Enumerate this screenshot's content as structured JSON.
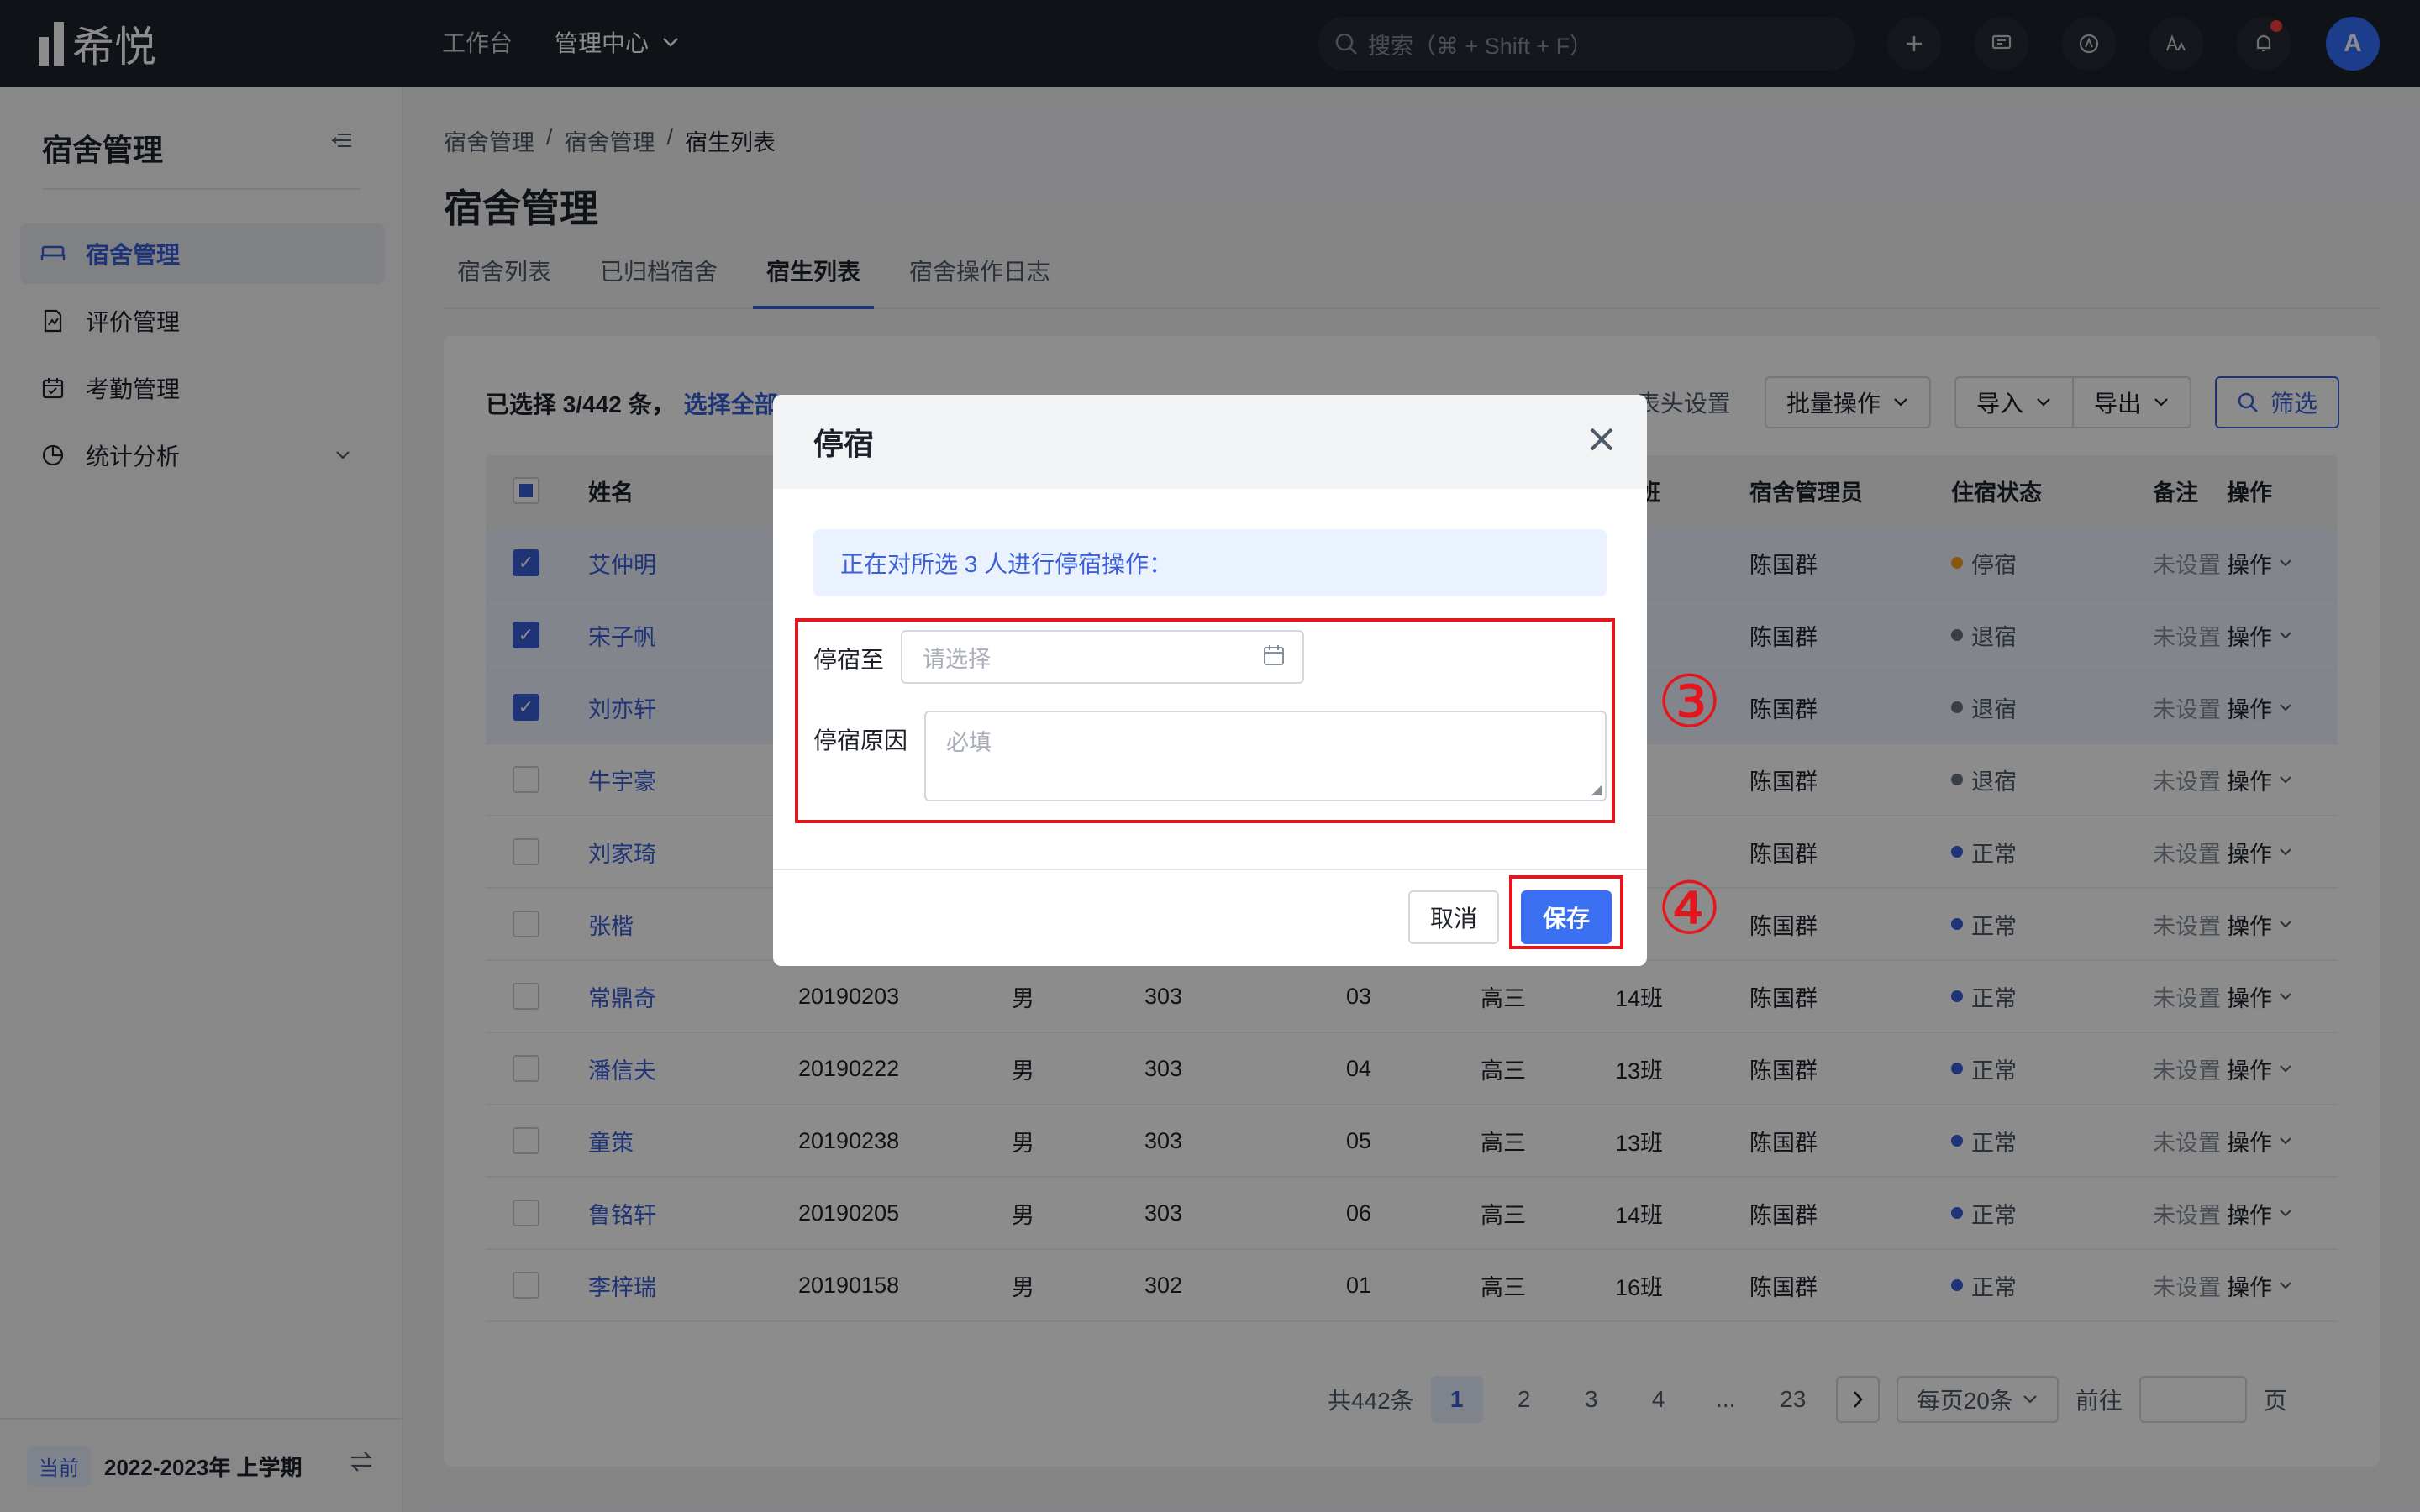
{
  "app": {
    "name": "希悦"
  },
  "topbar": {
    "nav": [
      "工作台",
      "管理中心"
    ],
    "search_placeholder": "搜索（⌘ + Shift + F）",
    "avatar_letter": "A"
  },
  "sidebar": {
    "title": "宿舍管理",
    "items": [
      {
        "label": "宿舍管理",
        "icon": "bed-icon",
        "active": true
      },
      {
        "label": "评价管理",
        "icon": "evaluation-icon"
      },
      {
        "label": "考勤管理",
        "icon": "calendar-icon"
      },
      {
        "label": "统计分析",
        "icon": "pie-chart-icon",
        "expandable": true
      }
    ],
    "term_tag": "当前",
    "term": "2022-2023年 上学期"
  },
  "breadcrumb": [
    "宿舍管理",
    "宿舍管理",
    "宿生列表"
  ],
  "page_title": "宿舍管理",
  "tabs": [
    "宿舍列表",
    "已归档宿舍",
    "宿生列表",
    "宿舍操作日志"
  ],
  "active_tab": 2,
  "toolbar": {
    "selection": "已选择 3/442 条，",
    "select_all": "选择全部",
    "column_settings": "表头设置",
    "batch": "批量操作",
    "import": "导入",
    "export": "导出",
    "filter": "筛选"
  },
  "table": {
    "headers": [
      "姓名",
      "教班",
      "宿舍管理员",
      "住宿状态",
      "备注",
      "操作"
    ],
    "rows": [
      {
        "name": "艾仲明",
        "id": "",
        "sex": "",
        "room": "",
        "bed": "",
        "grade": "",
        "class": "班",
        "manager": "陈国群",
        "status": "停宿",
        "status_color": "#f0a020",
        "note": "未设置",
        "op": "操作",
        "checked": true
      },
      {
        "name": "宋子帆",
        "id": "",
        "sex": "",
        "room": "",
        "bed": "",
        "grade": "",
        "class": "班",
        "manager": "陈国群",
        "status": "退宿",
        "status_color": "#6b7280",
        "note": "未设置",
        "op": "操作",
        "checked": true
      },
      {
        "name": "刘亦轩",
        "id": "",
        "sex": "",
        "room": "",
        "bed": "",
        "grade": "",
        "class": "班",
        "manager": "陈国群",
        "status": "退宿",
        "status_color": "#6b7280",
        "note": "未设置",
        "op": "操作",
        "checked": true
      },
      {
        "name": "牛宇豪",
        "id": "",
        "sex": "",
        "room": "",
        "bed": "",
        "grade": "",
        "class": "班",
        "manager": "陈国群",
        "status": "退宿",
        "status_color": "#6b7280",
        "note": "未设置",
        "op": "操作",
        "checked": false
      },
      {
        "name": "刘家琦",
        "id": "",
        "sex": "",
        "room": "",
        "bed": "",
        "grade": "",
        "class": "班",
        "manager": "陈国群",
        "status": "正常",
        "status_color": "#3a5fd9",
        "note": "未设置",
        "op": "操作",
        "checked": false
      },
      {
        "name": "张楷",
        "id": "",
        "sex": "",
        "room": "",
        "bed": "",
        "grade": "",
        "class": "班",
        "manager": "陈国群",
        "status": "正常",
        "status_color": "#3a5fd9",
        "note": "未设置",
        "op": "操作",
        "checked": false
      },
      {
        "name": "常鼎奇",
        "id": "20190203",
        "sex": "男",
        "room": "303",
        "bed": "03",
        "grade": "高三",
        "class": "14班",
        "manager": "陈国群",
        "status": "正常",
        "status_color": "#3a5fd9",
        "note": "未设置",
        "op": "操作",
        "checked": false
      },
      {
        "name": "潘信夫",
        "id": "20190222",
        "sex": "男",
        "room": "303",
        "bed": "04",
        "grade": "高三",
        "class": "13班",
        "manager": "陈国群",
        "status": "正常",
        "status_color": "#3a5fd9",
        "note": "未设置",
        "op": "操作",
        "checked": false
      },
      {
        "name": "童策",
        "id": "20190238",
        "sex": "男",
        "room": "303",
        "bed": "05",
        "grade": "高三",
        "class": "13班",
        "manager": "陈国群",
        "status": "正常",
        "status_color": "#3a5fd9",
        "note": "未设置",
        "op": "操作",
        "checked": false
      },
      {
        "name": "鲁铭轩",
        "id": "20190205",
        "sex": "男",
        "room": "303",
        "bed": "06",
        "grade": "高三",
        "class": "14班",
        "manager": "陈国群",
        "status": "正常",
        "status_color": "#3a5fd9",
        "note": "未设置",
        "op": "操作",
        "checked": false
      },
      {
        "name": "李梓瑞",
        "id": "20190158",
        "sex": "男",
        "room": "302",
        "bed": "01",
        "grade": "高三",
        "class": "16班",
        "manager": "陈国群",
        "status": "正常",
        "status_color": "#3a5fd9",
        "note": "未设置",
        "op": "操作",
        "checked": false
      }
    ]
  },
  "pagination": {
    "total": "共442条",
    "pages": [
      "1",
      "2",
      "3",
      "4",
      "...",
      "23"
    ],
    "current": "1",
    "page_size": "每页20条",
    "goto_label": "前往",
    "page_unit": "页"
  },
  "modal": {
    "title": "停宿",
    "notice": "正在对所选 3 人进行停宿操作：",
    "until_label": "停宿至",
    "until_placeholder": "请选择",
    "reason_label": "停宿原因",
    "reason_placeholder": "必填",
    "cancel": "取消",
    "save": "保存"
  },
  "annotations": {
    "step3": "③",
    "step4": "④",
    "color": "#e3161e"
  }
}
